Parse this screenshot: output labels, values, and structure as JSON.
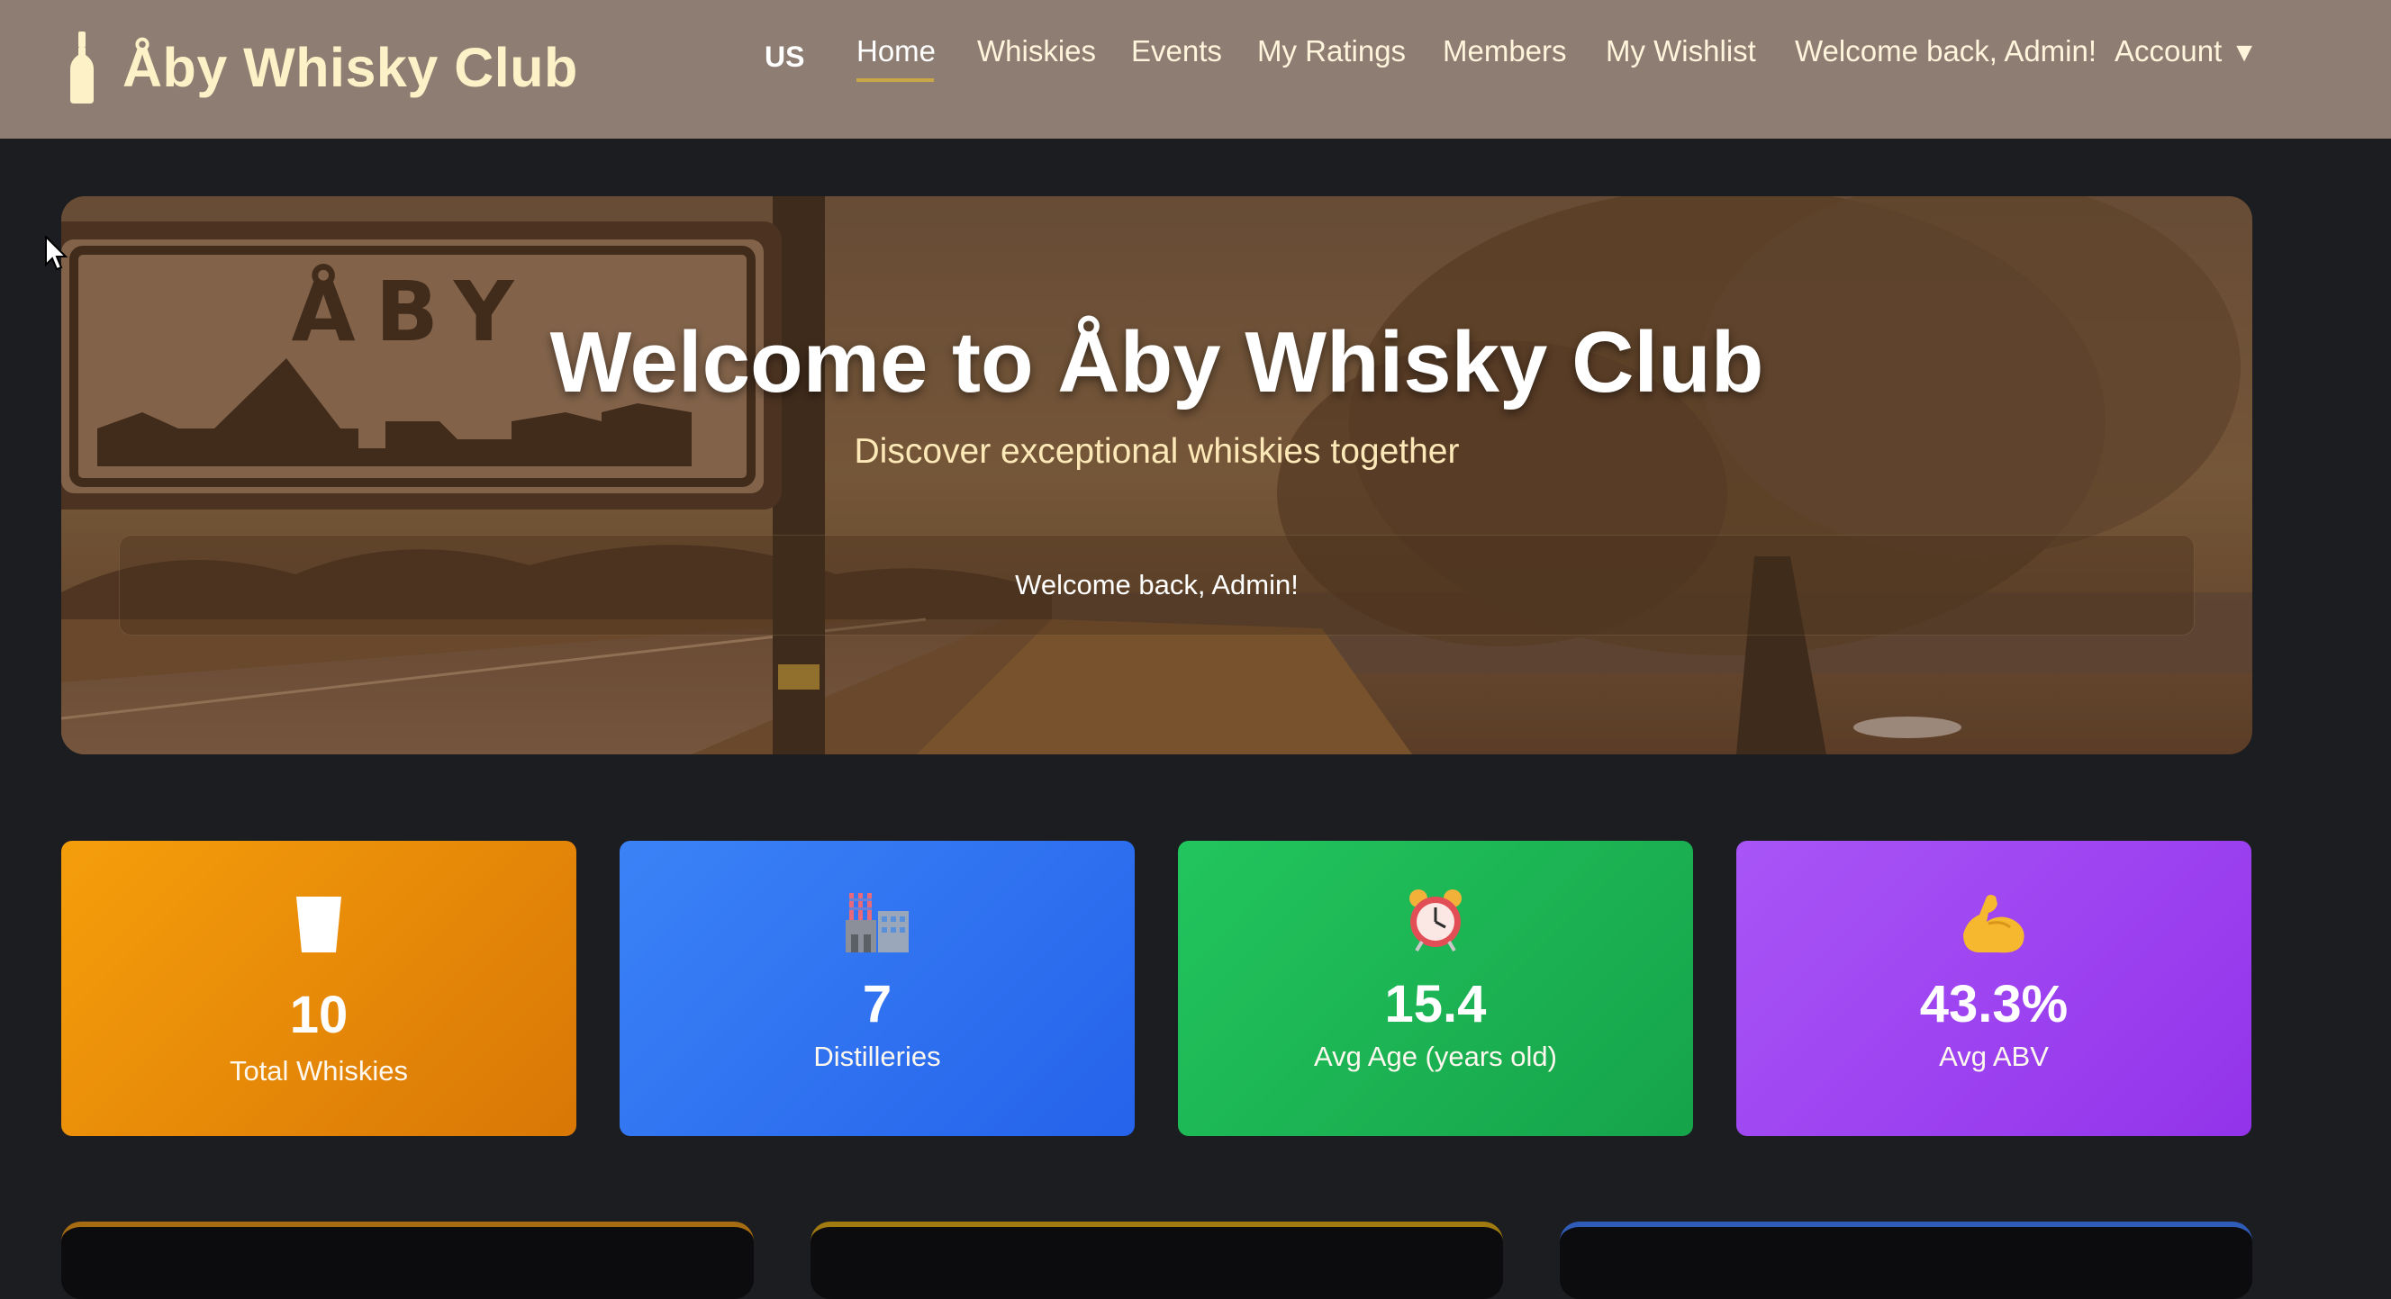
{
  "brand": {
    "name": "Åby Whisky Club",
    "logo_icon": "bottle-icon"
  },
  "nav": {
    "lang": "US",
    "items": [
      {
        "label": "Home",
        "active": true
      },
      {
        "label": "Whiskies"
      },
      {
        "label": "Events"
      },
      {
        "label": "My Ratings"
      },
      {
        "label": "Members"
      },
      {
        "label": "My Wishlist"
      }
    ],
    "welcome": "Welcome back, Admin!",
    "account": "Account",
    "account_caret": "▼"
  },
  "hero": {
    "title": "Welcome to Åby Whisky Club",
    "subtitle": "Discover exceptional whiskies together",
    "welcome_message": "Welcome back, Admin!",
    "sign_text": "ÅBY"
  },
  "stats": [
    {
      "icon": "glass-icon",
      "value": "10",
      "label": "Total Whiskies",
      "color": "#f59e0b"
    },
    {
      "icon": "factory-icon",
      "value": "7",
      "label": "Distilleries",
      "color": "#3b82f6"
    },
    {
      "icon": "alarm-clock-icon",
      "value": "15.4",
      "label": "Avg Age (years old)",
      "color": "#22c55e"
    },
    {
      "icon": "flexed-arm-icon",
      "value": "43.3%",
      "label": "Avg ABV",
      "color": "#a855f7"
    }
  ],
  "colors": {
    "topbar": "#8e7d72",
    "brand_text": "#fdf1c7",
    "active_underline": "#c9a646",
    "page_bg": "#1c1d20"
  }
}
